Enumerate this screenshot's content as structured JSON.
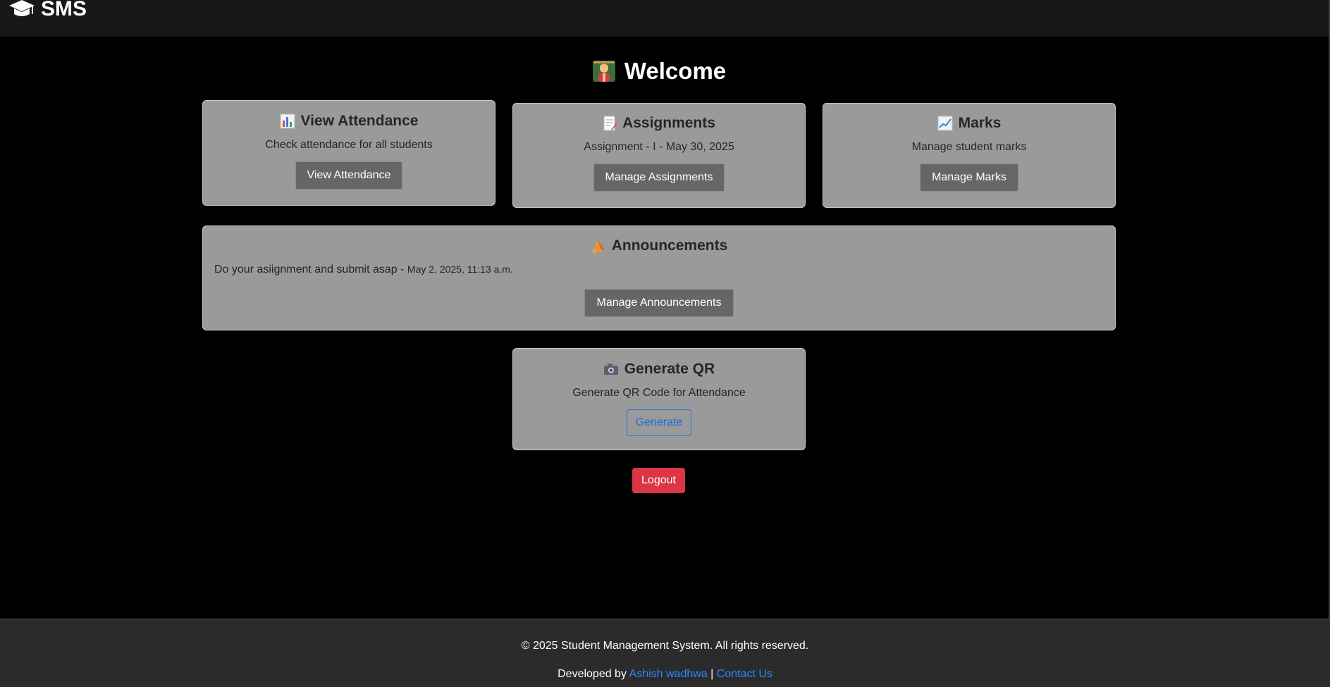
{
  "navbar": {
    "brand": "SMS",
    "brand_icon": "graduation-cap-icon"
  },
  "welcome": {
    "title": "Welcome",
    "icon": "teacher-icon"
  },
  "cards": {
    "attendance": {
      "title": "View Attendance",
      "icon": "bar-chart-icon",
      "text": "Check attendance for all students",
      "button": "View Attendance"
    },
    "assignments": {
      "title": "Assignments",
      "icon": "memo-icon",
      "text": "Assignment - I - May 30, 2025",
      "button": "Manage Assignments"
    },
    "marks": {
      "title": "Marks",
      "icon": "chart-increasing-icon",
      "text": "Manage student marks",
      "button": "Manage Marks"
    },
    "announcements": {
      "title": "Announcements",
      "icon": "megaphone-icon",
      "item_text": "Do your asiignment and submit asap -",
      "item_date": "May 2, 2025, 11:13 a.m.",
      "button": "Manage Announcements"
    },
    "qr": {
      "title": "Generate QR",
      "icon": "camera-icon",
      "text": "Generate QR Code for Attendance",
      "button": "Generate"
    }
  },
  "logout": "Logout",
  "footer": {
    "copyright": "© 2025 Student Management System. All rights reserved.",
    "developed_by": "Developed by",
    "author": "Ashish wadhwa",
    "separator": "|",
    "contact": "Contact Us"
  },
  "colors": {
    "card_bg": "#9a9a9a",
    "button_dark": "#666666",
    "danger": "#dc3545",
    "link": "#2f86ff"
  }
}
